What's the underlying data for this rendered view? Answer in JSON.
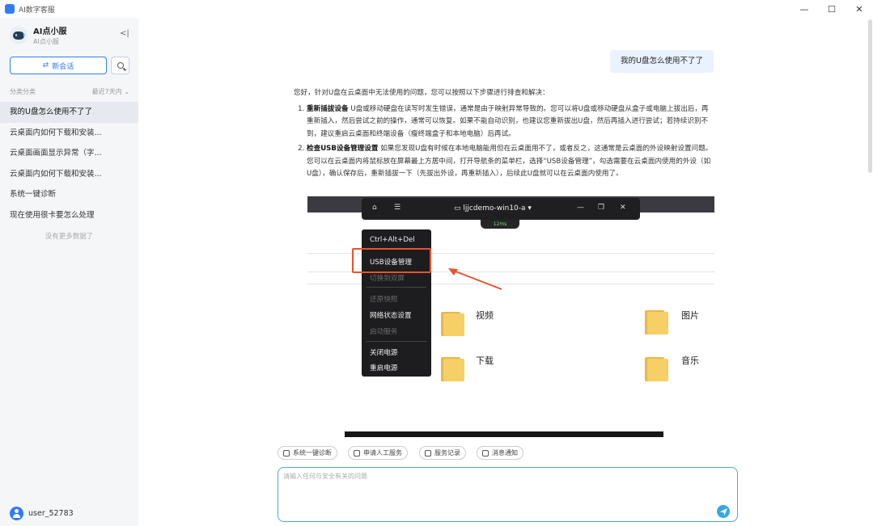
{
  "window": {
    "title": "AI数字客服"
  },
  "sidebar": {
    "brand_name": "AI点小服",
    "brand_sub": "AI点小服",
    "new_chat_label": "新会话",
    "filter_label": "分类分类",
    "filter_value": "最近7天内",
    "history": [
      {
        "label": "我的U盘怎么使用不了了"
      },
      {
        "label": "云桌面内如何下载和安装..."
      },
      {
        "label": "云桌面画面显示异常（字..."
      },
      {
        "label": "云桌面内如何下载和安装..."
      },
      {
        "label": "系统一键诊断"
      },
      {
        "label": "现在使用很卡要怎么处理"
      }
    ],
    "no_more": "没有更多数据了",
    "username": "user_52783"
  },
  "chat": {
    "user_message": "我的U盘怎么使用不了了",
    "answer_intro": "您好，针对U盘在云桌面中无法使用的问题，您可以按照以下步骤进行排查和解决：",
    "steps": [
      {
        "title": "重新插拔设备",
        "body": "U盘或移动硬盘在读写时发生错误，通常是由于映射异常导致的。您可以将U盘或移动硬盘从盒子或电脑上拔出后，再重新插入，然后尝试之前的操作，通常可以恢复。如果不能自动识别，也建议您重新拔出U盘，然后再插入进行尝试；若持续识别不到，建议重启云桌面和终端设备（瘦终端盒子和本地电脑）后再试。"
      },
      {
        "title": "检查USB设备管理设置",
        "body": "如果您发现U盘有时候在本地电脑能用但在云桌面用不了，或者反之，这通常是云桌面的外设映射设置问题。您可以在云桌面内将鼠标放在屏幕最上方居中间，打开导航条的菜单栏，选择“USB设备管理”，勾选需要在云桌面内使用的外设（如U盘），确认保存后，重新插拔一下（先拔出外设，再重新插入），后续此U盘就可以在云桌面内使用了。"
      }
    ],
    "screenshot": {
      "host": "ljjcdemo-win10-a",
      "signal": "12ms",
      "menu": {
        "ctrl_alt_del": "Ctrl+Alt+Del",
        "usb": "USB设备管理",
        "dual_screen": "切换到双屏",
        "restore": "还原快照",
        "network": "网络状态设置",
        "service": "启动服务",
        "shutdown": "关闭电源",
        "restart": "重启电源"
      },
      "folders": {
        "videos": "视频",
        "pictures": "图片",
        "downloads": "下载",
        "music": "音乐"
      }
    }
  },
  "quick_actions": [
    {
      "label": "系统一键诊断"
    },
    {
      "label": "申请人工服务"
    },
    {
      "label": "服务记录"
    },
    {
      "label": "消息通知"
    }
  ],
  "input": {
    "placeholder": "请输入任何与安全有关的问题"
  },
  "colors": {
    "accent": "#2f7cf6",
    "highlight": "#e8522f"
  }
}
